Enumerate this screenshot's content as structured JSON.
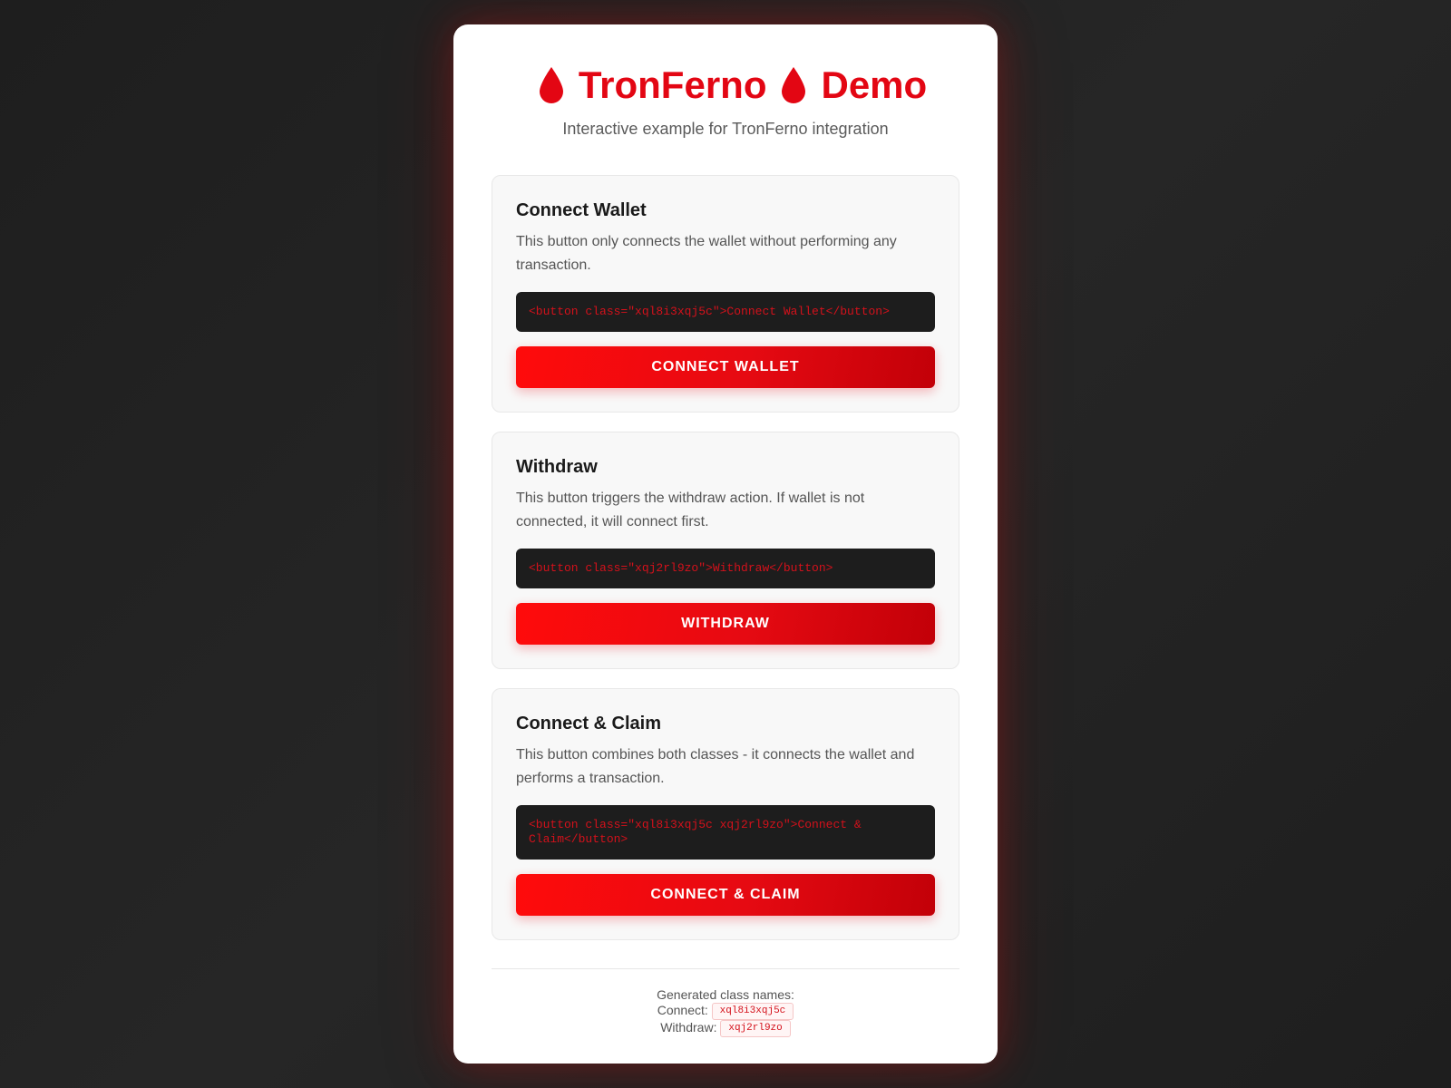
{
  "header": {
    "title_left": "TronFerno",
    "title_right": "Demo",
    "subtitle": "Interactive example for TronFerno integration",
    "icon": "blood-drop-icon",
    "accent_color": "#e30613"
  },
  "sections": [
    {
      "title": "Connect Wallet",
      "description": "This button only connects the wallet without performing any transaction.",
      "code": "<button class=\"xql8i3xqj5c\">Connect Wallet</button>",
      "button_label": "CONNECT WALLET"
    },
    {
      "title": "Withdraw",
      "description": "This button triggers the withdraw action. If wallet is not connected, it will connect first.",
      "code": "<button class=\"xqj2rl9zo\">Withdraw</button>",
      "button_label": "WITHDRAW"
    },
    {
      "title": "Connect & Claim",
      "description": "This button combines both classes - it connects the wallet and performs a transaction.",
      "code": "<button class=\"xql8i3xqj5c xqj2rl9zo\">Connect & Claim</button>",
      "button_label": "CONNECT & CLAIM"
    }
  ],
  "footer": {
    "heading": "Generated class names:",
    "connect_label": "Connect:",
    "connect_class": "xql8i3xqj5c",
    "withdraw_label": "Withdraw:",
    "withdraw_class": "xqj2rl9zo"
  },
  "colors": {
    "background": "#222222",
    "card": "#ffffff",
    "button_gradient_start": "#ff0b0b",
    "button_gradient_end": "#c20008",
    "code_background": "#1d1d1d"
  }
}
